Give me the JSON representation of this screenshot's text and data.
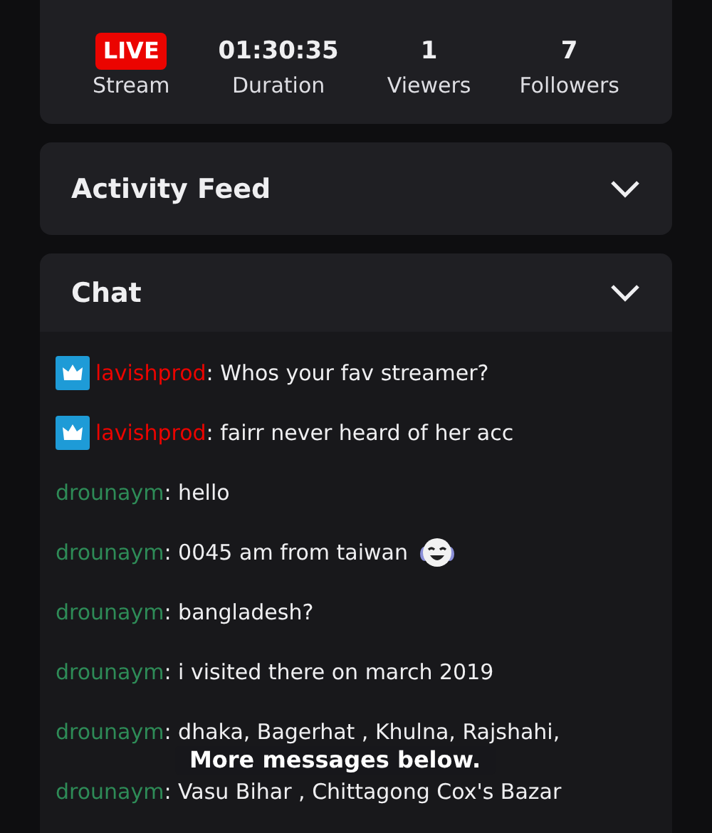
{
  "stats": [
    {
      "kind": "badge",
      "value": "LIVE",
      "label": "Stream"
    },
    {
      "kind": "number",
      "value": "01:30:35",
      "label": "Duration"
    },
    {
      "kind": "number",
      "value": "1",
      "label": "Viewers"
    },
    {
      "kind": "number",
      "value": "7",
      "label": "Followers"
    }
  ],
  "activity_feed": {
    "title": "Activity Feed"
  },
  "chat": {
    "title": "Chat",
    "messages": [
      {
        "vip": true,
        "user": "lavishprod",
        "color": "#eb0400",
        "text": ": Whos your fav streamer?",
        "emote": false
      },
      {
        "vip": true,
        "user": "lavishprod",
        "color": "#eb0400",
        "text": ": fairr never heard of her acc",
        "emote": false
      },
      {
        "vip": false,
        "user": "drounaym",
        "color": "#2e8b57",
        "text": ": hello",
        "emote": false
      },
      {
        "vip": false,
        "user": "drounaym",
        "color": "#2e8b57",
        "text": ": 0045 am from taiwan",
        "emote": true
      },
      {
        "vip": false,
        "user": "drounaym",
        "color": "#2e8b57",
        "text": ": bangladesh?",
        "emote": false
      },
      {
        "vip": false,
        "user": "drounaym",
        "color": "#2e8b57",
        "text": ": i visited there on march 2019",
        "emote": false
      },
      {
        "vip": false,
        "user": "drounaym",
        "color": "#2e8b57",
        "text": ": dhaka, Bagerhat , Khulna, Rajshahi,",
        "emote": false
      },
      {
        "vip": false,
        "user": "drounaym",
        "color": "#2e8b57",
        "text": ": Vasu Bihar , Chittagong Cox's Bazar",
        "emote": false
      }
    ],
    "notice": "More messages below."
  }
}
